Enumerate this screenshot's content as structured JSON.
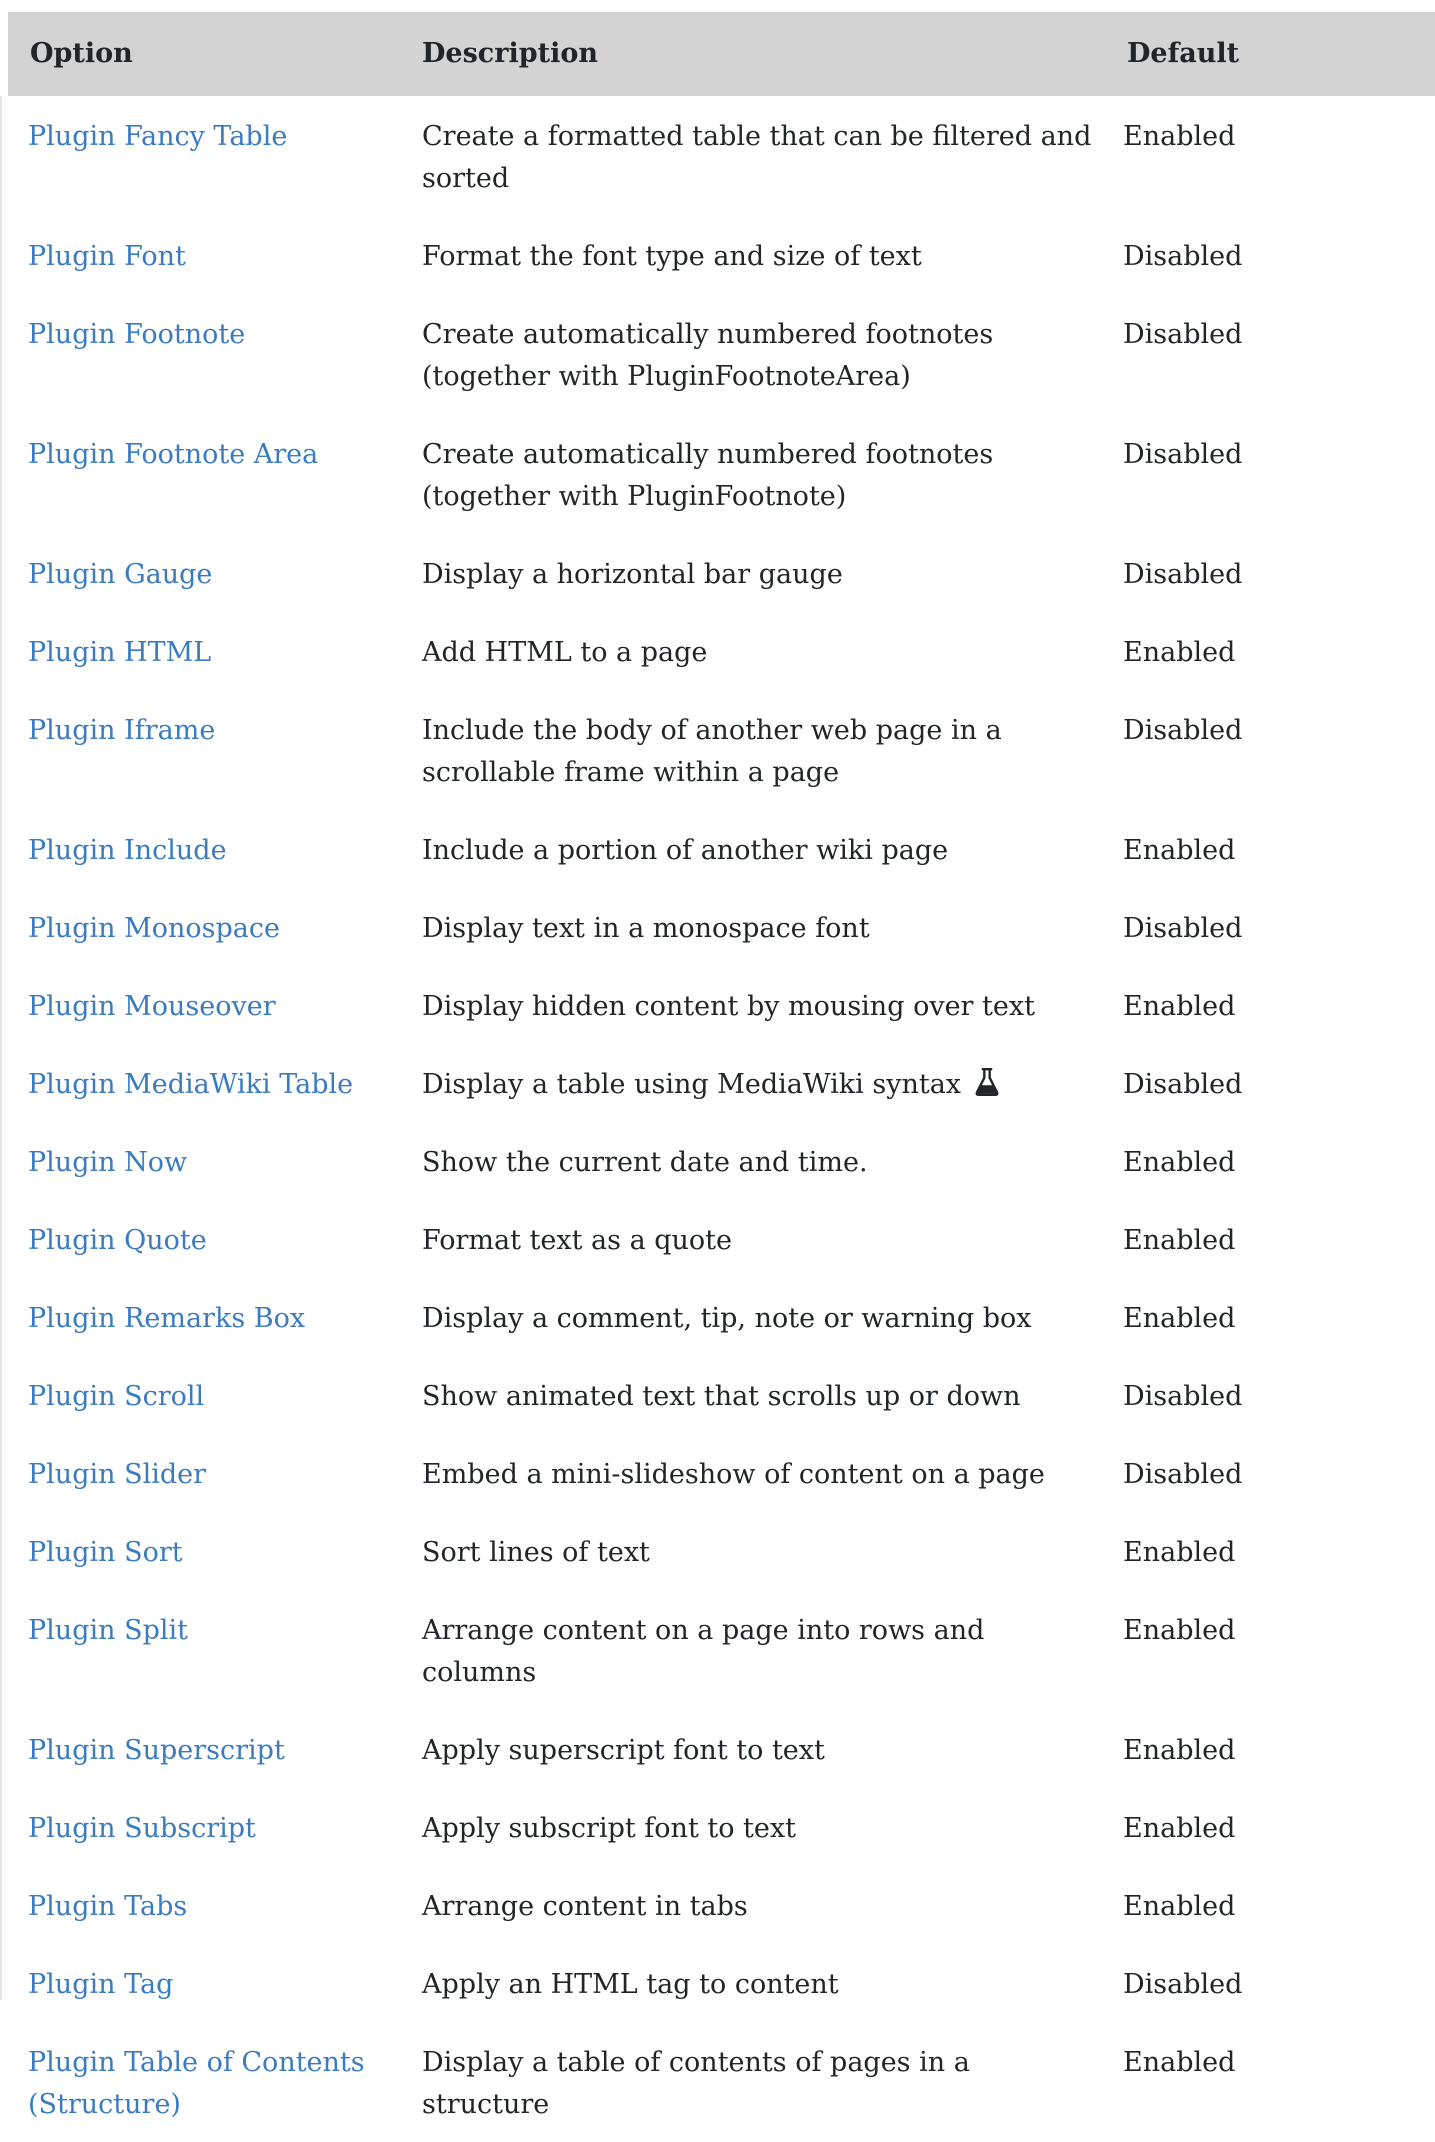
{
  "table": {
    "headers": {
      "option": "Option",
      "description": "Description",
      "default": "Default"
    },
    "rows": [
      {
        "option": "Plugin Fancy Table",
        "description": "Create a formatted table that can be filtered and sorted",
        "default": "Enabled"
      },
      {
        "option": "Plugin Font",
        "description": "Format the font type and size of text",
        "default": "Disabled"
      },
      {
        "option": "Plugin Footnote",
        "description": "Create automatically numbered footnotes (together with PluginFootnoteArea)",
        "default": "Disabled"
      },
      {
        "option": "Plugin Footnote Area",
        "description": "Create automatically numbered footnotes (together with PluginFootnote)",
        "default": "Disabled"
      },
      {
        "option": "Plugin Gauge",
        "description": "Display a horizontal bar gauge",
        "default": "Disabled"
      },
      {
        "option": "Plugin HTML",
        "description": "Add HTML to a page",
        "default": "Enabled"
      },
      {
        "option": "Plugin Iframe",
        "description": "Include the body of another web page in a scrollable frame within a page",
        "default": "Disabled"
      },
      {
        "option": "Plugin Include",
        "description": "Include a portion of another wiki page",
        "default": "Enabled"
      },
      {
        "option": "Plugin Monospace",
        "description": "Display text in a monospace font",
        "default": "Disabled"
      },
      {
        "option": "Plugin Mouseover",
        "description": "Display hidden content by mousing over text",
        "default": "Enabled"
      },
      {
        "option": "Plugin MediaWiki Table",
        "description": "Display a table using MediaWiki syntax",
        "default": "Disabled",
        "icon": "flask-icon"
      },
      {
        "option": "Plugin Now",
        "description": "Show the current date and time.",
        "default": "Enabled"
      },
      {
        "option": "Plugin Quote",
        "description": "Format text as a quote",
        "default": "Enabled"
      },
      {
        "option": "Plugin Remarks Box",
        "description": "Display a comment, tip, note or warning box",
        "default": "Enabled"
      },
      {
        "option": "Plugin Scroll",
        "description": "Show animated text that scrolls up or down",
        "default": "Disabled"
      },
      {
        "option": "Plugin Slider",
        "description": "Embed a mini-slideshow of content on a page",
        "default": "Disabled"
      },
      {
        "option": "Plugin Sort",
        "description": "Sort lines of text",
        "default": "Enabled"
      },
      {
        "option": "Plugin Split",
        "description": "Arrange content on a page into rows and columns",
        "default": "Enabled"
      },
      {
        "option": "Plugin Superscript",
        "description": "Apply superscript font to text",
        "default": "Enabled"
      },
      {
        "option": "Plugin Subscript",
        "description": "Apply subscript font to text",
        "default": "Enabled"
      },
      {
        "option": "Plugin Tabs",
        "description": "Arrange content in tabs",
        "default": "Enabled"
      },
      {
        "option": "Plugin Tag",
        "description": "Apply an HTML tag to content",
        "default": "Disabled"
      },
      {
        "option": "Plugin Table of Contents (Structure)",
        "description": "Display a table of contents of pages in a structure",
        "default": "Enabled"
      }
    ]
  },
  "colors": {
    "header_bg": "#d3d3d3",
    "link": "#3b7bbf",
    "text": "#212529"
  }
}
